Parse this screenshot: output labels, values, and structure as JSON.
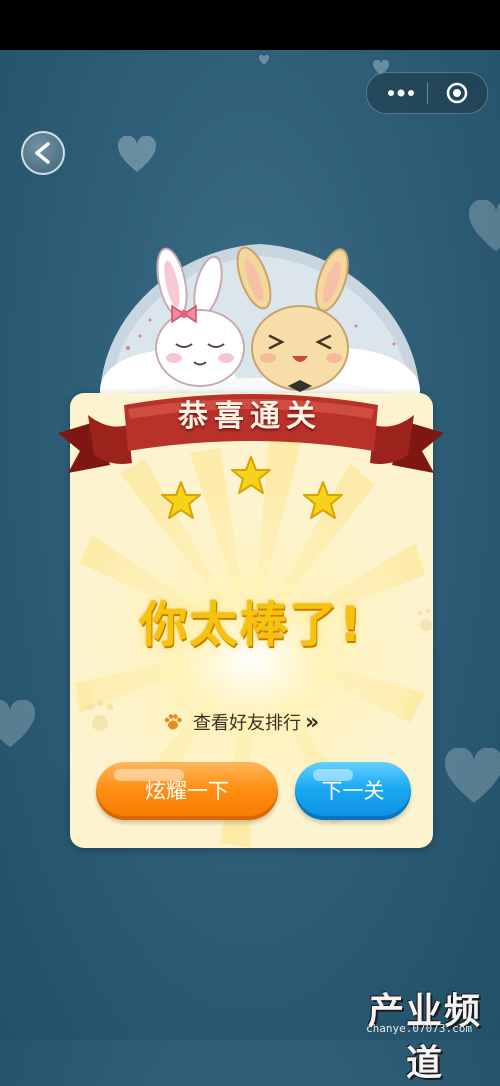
{
  "title_banner": "恭喜通关",
  "message": "你太棒了!",
  "ranking_link": "查看好友排行",
  "ranking_chevron": "»",
  "buttons": {
    "show_off": "炫耀一下",
    "next_level": "下一关"
  },
  "stars": 3,
  "icons": {
    "back": "back-chevron-icon",
    "more": "more-dots-icon",
    "close": "close-target-icon",
    "paw": "paw-icon",
    "star": "star-icon"
  },
  "watermark": {
    "main": "产业频道",
    "sub": "chanye.07073.com"
  },
  "colors": {
    "background": "#2f5f78",
    "panel": "#fdf4cf",
    "ribbon": "#b52a22",
    "orange_button": "#ff8f14",
    "blue_button": "#1aa9f2",
    "star": "#f7d21a"
  }
}
